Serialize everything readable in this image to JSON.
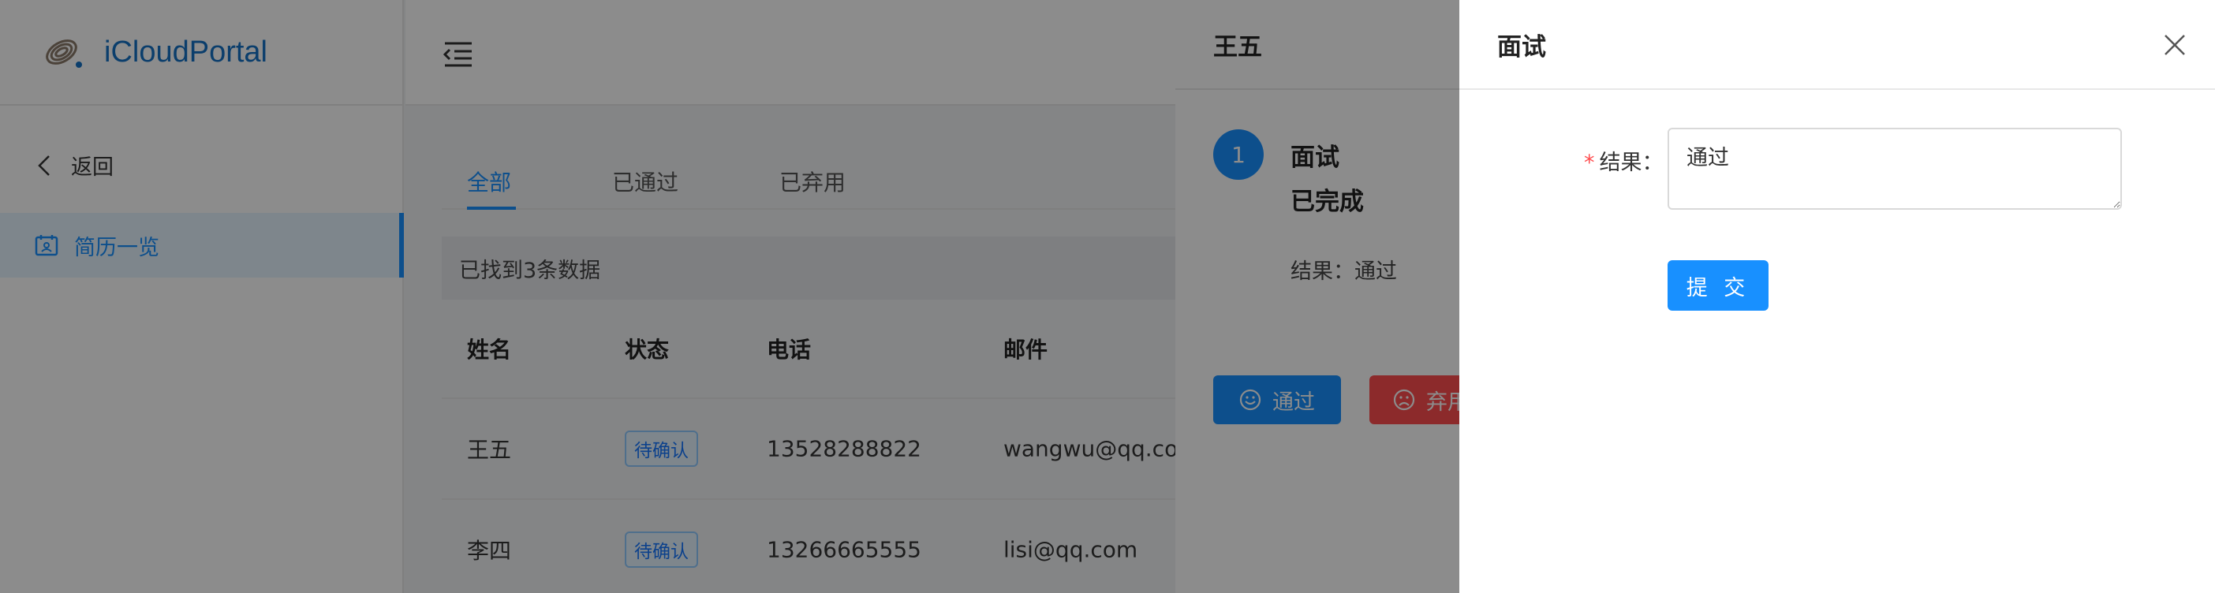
{
  "app": {
    "name": "iCloudPortal"
  },
  "sidebar": {
    "back_label": "返回",
    "menu_item": "简历一览"
  },
  "tabs": [
    {
      "label": "全部"
    },
    {
      "label": "已通过"
    },
    {
      "label": "已弃用"
    }
  ],
  "info_bar": {
    "text": "已找到3条数据"
  },
  "table": {
    "headers": [
      "姓名",
      "状态",
      "电话",
      "邮件"
    ],
    "rows": [
      {
        "name": "王五",
        "status": "待确认",
        "phone": "13528288822",
        "email": "wangwu@qq.com"
      },
      {
        "name": "李四",
        "status": "待确认",
        "phone": "13266665555",
        "email": "lisi@qq.com"
      }
    ]
  },
  "drawer1": {
    "title": "王五",
    "step_number": "1",
    "step_title": "面试",
    "step_status": "已完成",
    "result_line": "结果：通过",
    "pass_button": "通过",
    "reject_button": "弃用"
  },
  "drawer2": {
    "title": "面试",
    "result_label": "结果：",
    "result_value": "通过",
    "submit_button": "提 交"
  },
  "colors": {
    "primary": "#1890ff",
    "danger": "#ff4d4f",
    "logo": "#1572c5"
  },
  "icons": [
    "logo-mark",
    "chevron-left-icon",
    "resume-icon",
    "menu-fold-icon",
    "smile-icon",
    "frown-icon",
    "close-icon"
  ]
}
